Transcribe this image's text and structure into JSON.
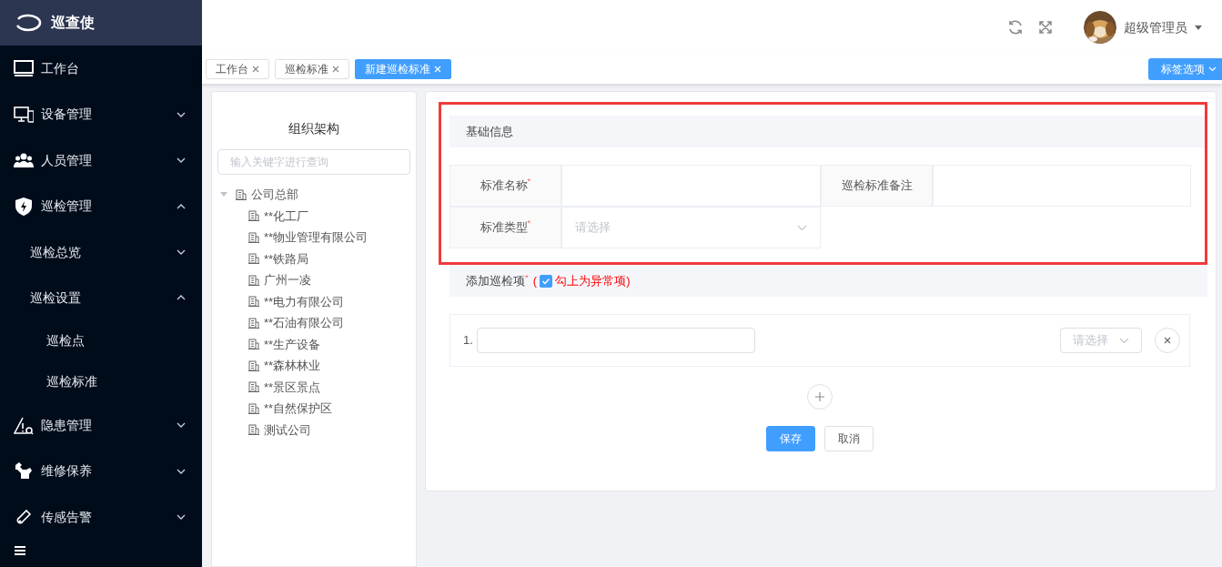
{
  "app": {
    "title": "巡查使"
  },
  "sidebar": {
    "items": [
      {
        "label": "工作台"
      },
      {
        "label": "设备管理",
        "expanded": false
      },
      {
        "label": "人员管理",
        "expanded": false
      },
      {
        "label": "巡检管理",
        "expanded": true,
        "children": [
          {
            "label": "巡检总览",
            "expanded": false
          },
          {
            "label": "巡检设置",
            "expanded": true,
            "children": [
              {
                "label": "巡检点"
              },
              {
                "label": "巡检标准"
              }
            ]
          }
        ]
      },
      {
        "label": "隐患管理",
        "expanded": false
      },
      {
        "label": "维修保养",
        "expanded": false
      },
      {
        "label": "传感告警",
        "expanded": false
      }
    ]
  },
  "header": {
    "user": "超级管理员"
  },
  "tabs": [
    {
      "label": "工作台",
      "selected": false
    },
    {
      "label": "巡检标准",
      "selected": false
    },
    {
      "label": "新建巡检标准",
      "selected": true
    }
  ],
  "tab_options": "标签选项",
  "org_panel": {
    "title": "组织架构",
    "search": {
      "placeholder": "输入关键字进行查询"
    },
    "tree": [
      {
        "label": "公司总部",
        "expanded": true,
        "children": [
          {
            "label": "**化工厂"
          },
          {
            "label": "**物业管理有限公司"
          },
          {
            "label": "**铁路局"
          },
          {
            "label": "广州一凌"
          },
          {
            "label": "**电力有限公司"
          },
          {
            "label": "**石油有限公司"
          },
          {
            "label": "**生产设备"
          },
          {
            "label": "**森林林业"
          },
          {
            "label": "**景区景点"
          },
          {
            "label": "**自然保护区"
          },
          {
            "label": "测试公司"
          }
        ]
      }
    ]
  },
  "form": {
    "basic": {
      "title": "基础信息",
      "highlighted": true,
      "fields": [
        {
          "label": "标准名称$^{*}$",
          "kind": "text"
        },
        {
          "label": "巡检标准备注",
          "kind": "text"
        },
        {
          "label": "标准类型$^{*}$",
          "kind": "select",
          "placeholder": "请选择"
        }
      ]
    },
    "items_section": {
      "title": "添加巡检项$^{*}$",
      "note_prefix": "(",
      "note_checked": true,
      "note": "勾上为异常项)",
      "items": [
        {
          "number": "1.",
          "select_placeholder": "请选择"
        }
      ]
    },
    "buttons": [
      {
        "label": "保存",
        "kind": "primary"
      },
      {
        "label": "取消",
        "kind": "default"
      }
    ]
  }
}
